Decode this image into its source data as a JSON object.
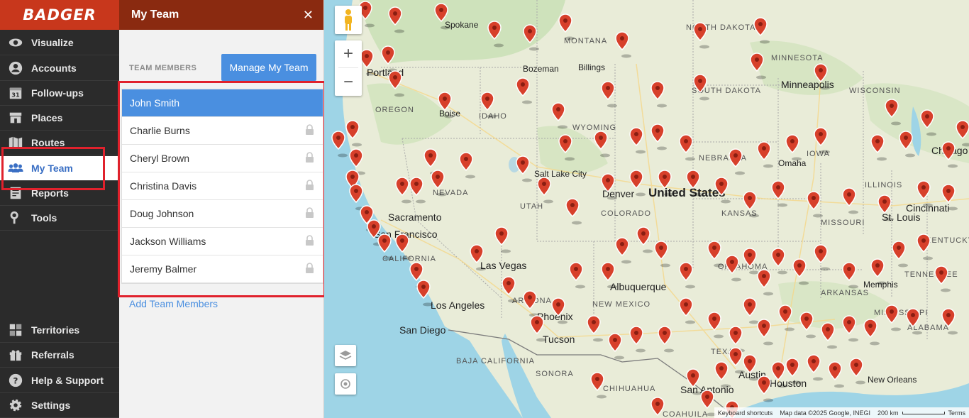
{
  "app": {
    "logo": "BADGER"
  },
  "nav": {
    "items": [
      {
        "label": "Visualize",
        "icon": "eye-icon"
      },
      {
        "label": "Accounts",
        "icon": "user-circle-icon"
      },
      {
        "label": "Follow-ups",
        "icon": "calendar-icon"
      },
      {
        "label": "Places",
        "icon": "store-icon"
      },
      {
        "label": "Routes",
        "icon": "map-icon"
      },
      {
        "label": "My Team",
        "icon": "team-icon",
        "active": true
      },
      {
        "label": "Reports",
        "icon": "reports-icon"
      },
      {
        "label": "Tools",
        "icon": "wrench-icon"
      }
    ],
    "bottom_items": [
      {
        "label": "Territories",
        "icon": "territories-icon"
      },
      {
        "label": "Referrals",
        "icon": "gift-icon"
      },
      {
        "label": "Help & Support",
        "icon": "help-icon"
      },
      {
        "label": "Settings",
        "icon": "gear-icon"
      }
    ]
  },
  "panel": {
    "title": "My Team",
    "close_glyph": "✕",
    "members_heading": "TEAM MEMBERS",
    "manage_button": "Manage My Team",
    "members": [
      {
        "name": "John Smith",
        "selected": true
      },
      {
        "name": "Charlie Burns",
        "locked": true
      },
      {
        "name": "Cheryl Brown",
        "locked": true
      },
      {
        "name": "Christina Davis",
        "locked": true
      },
      {
        "name": "Doug Johnson",
        "locked": true
      },
      {
        "name": "Jackson Williams",
        "locked": true
      },
      {
        "name": "Jeremy Balmer",
        "locked": true
      }
    ],
    "add_link": "Add Team Members"
  },
  "map": {
    "country": "United States",
    "regions": [
      "MONTANA",
      "NORTH DAKOTA",
      "MINNESOTA",
      "WISCONSIN",
      "SOUTH DAKOTA",
      "OREGON",
      "IDAHO",
      "WYOMING",
      "NEBRASKA",
      "IOWA",
      "ILLINOIS",
      "NEVADA",
      "UTAH",
      "COLORADO",
      "KANSAS",
      "MISSOURI",
      "CALIFORNIA",
      "ARIZONA",
      "NEW MEXICO",
      "OKLAHOMA",
      "ARKANSAS",
      "TENNESSEE",
      "KENTUCKY",
      "TEXAS",
      "MISSISSIPPI",
      "ALABAMA",
      "BAJA CALIFORNIA",
      "SONORA",
      "CHIHUAHUA",
      "COAHUILA"
    ],
    "cities": [
      "Portland",
      "Spokane",
      "Boise",
      "Bozeman",
      "Billings",
      "Minneapolis",
      "Salt Lake City",
      "Omaha",
      "Sacramento",
      "San Francisco",
      "Las Vegas",
      "Los Angeles",
      "San Diego",
      "Phoenix",
      "Tucson",
      "Albuquerque",
      "Denver",
      "St. Louis",
      "Cincinnati",
      "Chicago",
      "Memphis",
      "Houston",
      "Austin",
      "San Antonio",
      "New Orleans"
    ],
    "attribution": {
      "keyboard": "Keyboard shortcuts",
      "data": "Map data ©2025 Google, INEGI",
      "scale": "200 km",
      "terms": "Terms"
    },
    "zoom_in": "+",
    "zoom_out": "−",
    "pin_color": "#d7402b"
  }
}
